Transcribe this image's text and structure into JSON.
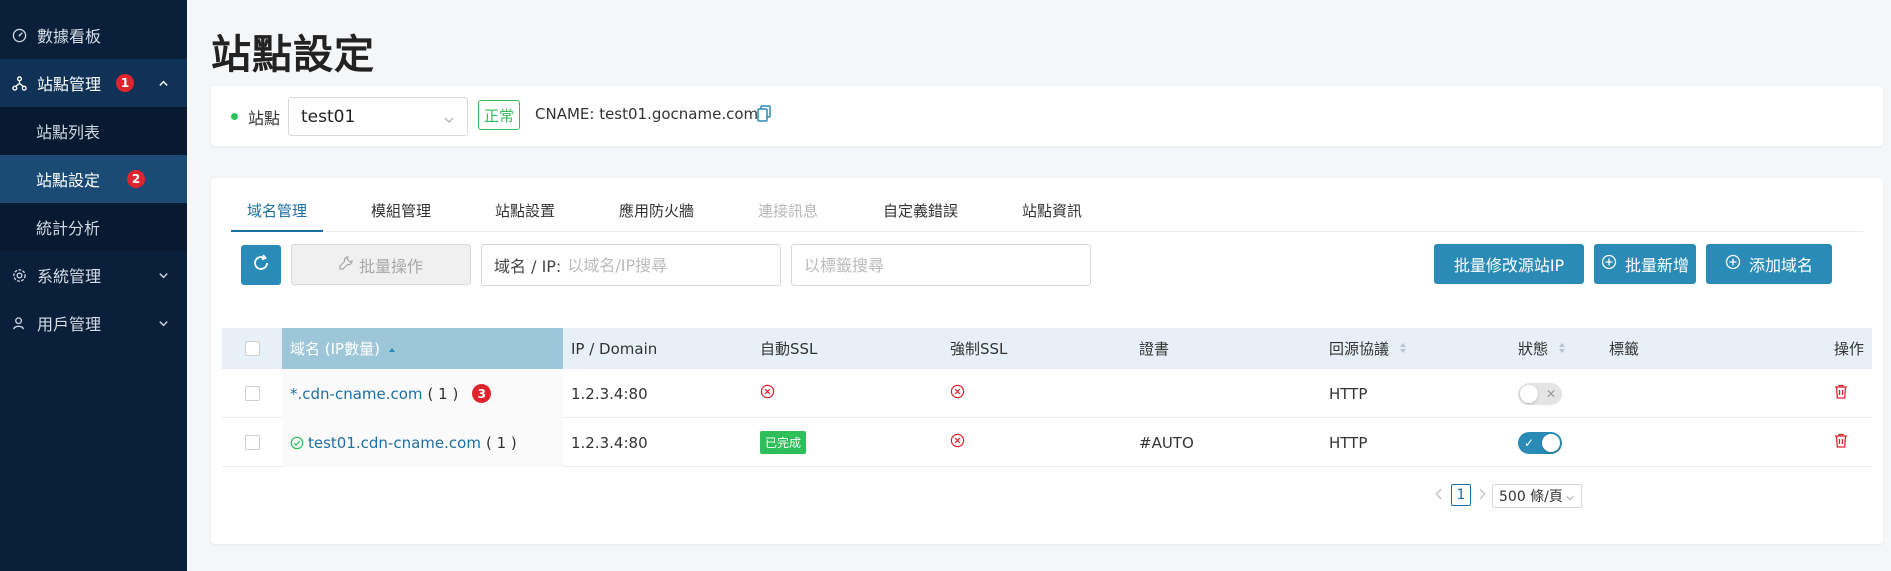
{
  "sidebar": {
    "items": [
      {
        "label": "數據看板",
        "icon": "dashboard-icon"
      },
      {
        "label": "站點管理",
        "icon": "sitemap-icon",
        "badge": "1",
        "expanded": true,
        "children": [
          {
            "label": "站點列表"
          },
          {
            "label": "站點設定",
            "badge": "2",
            "active": true
          },
          {
            "label": "統計分析"
          }
        ]
      },
      {
        "label": "系統管理",
        "icon": "gear-icon"
      },
      {
        "label": "用戶管理",
        "icon": "user-icon"
      }
    ]
  },
  "page": {
    "title": "站點設定"
  },
  "site_bar": {
    "label": "站點",
    "selected_site": "test01",
    "status": "正常",
    "cname": "CNAME: test01.gocname.com."
  },
  "tabs": [
    {
      "label": "域名管理",
      "active": true
    },
    {
      "label": "模組管理"
    },
    {
      "label": "站點設置"
    },
    {
      "label": "應用防火牆"
    },
    {
      "label": "連接訊息",
      "disabled": true
    },
    {
      "label": "自定義錯誤"
    },
    {
      "label": "站點資訊"
    }
  ],
  "toolbar": {
    "batch_label": "批量操作",
    "search_prefix": "域名 / IP:",
    "search_placeholder": "以域名/IP搜尋",
    "tag_placeholder": "以標籤搜尋",
    "batch_edit_ip_label": "批量修改源站IP",
    "batch_add_label": "批量新增",
    "add_domain_label": "添加域名"
  },
  "table": {
    "columns": [
      "域名 (IP數量)",
      "IP / Domain",
      "自動SSL",
      "強制SSL",
      "證書",
      "回源協議",
      "狀態",
      "標籤",
      "操作"
    ],
    "rows": [
      {
        "domain": "*.cdn-cname.com",
        "count": "( 1 )",
        "badge": "3",
        "ip": "1.2.3.4:80",
        "auto_ssl": "error",
        "force_ssl": "error",
        "cert": "",
        "protocol": "HTTP",
        "status_on": false,
        "tag": ""
      },
      {
        "domain": "test01.cdn-cname.com",
        "count": "( 1 )",
        "verified": true,
        "ip": "1.2.3.4:80",
        "auto_ssl": "已完成",
        "force_ssl": "error",
        "cert": "#AUTO",
        "protocol": "HTTP",
        "status_on": true,
        "tag": ""
      }
    ]
  },
  "pagination": {
    "current_page": "1",
    "page_size": "500 條/頁"
  },
  "colors": {
    "accent": "#2a8cb6",
    "sidebar_bg": "#0a1f3a",
    "success": "#2fbf5a",
    "danger": "#e0242d"
  }
}
